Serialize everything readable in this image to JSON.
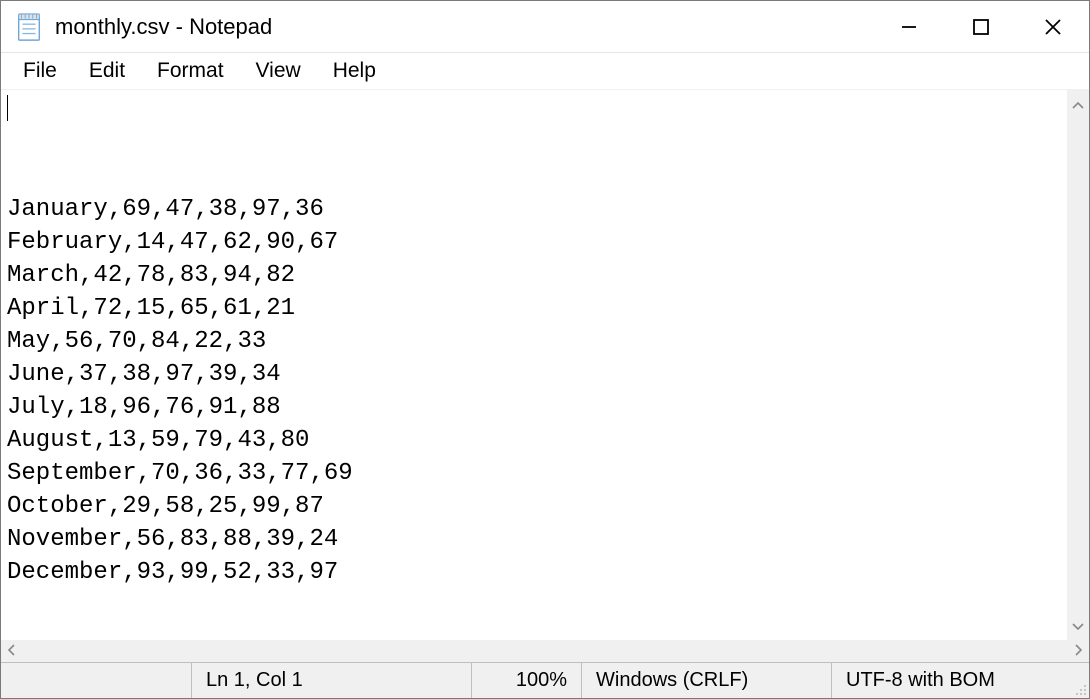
{
  "title": "monthly.csv - Notepad",
  "menus": {
    "file": "File",
    "edit": "Edit",
    "format": "Format",
    "view": "View",
    "help": "Help"
  },
  "content_lines": [
    "January,69,47,38,97,36",
    "February,14,47,62,90,67",
    "March,42,78,83,94,82",
    "April,72,15,65,61,21",
    "May,56,70,84,22,33",
    "June,37,38,97,39,34",
    "July,18,96,76,91,88",
    "August,13,59,79,43,80",
    "September,70,36,33,77,69",
    "October,29,58,25,99,87",
    "November,56,83,88,39,24",
    "December,93,99,52,33,97"
  ],
  "status": {
    "position": "Ln 1, Col 1",
    "zoom": "100%",
    "line_ending": "Windows (CRLF)",
    "encoding": "UTF-8 with BOM"
  }
}
